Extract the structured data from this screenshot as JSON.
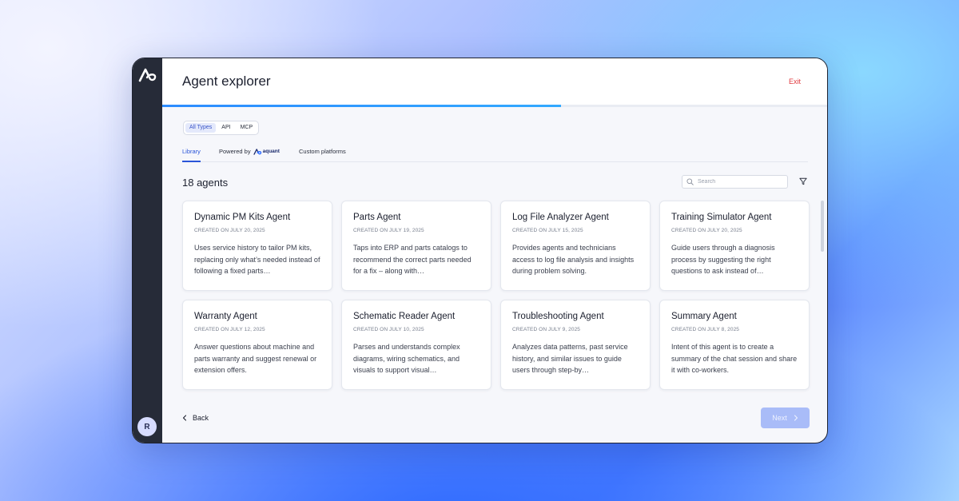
{
  "header": {
    "title": "Agent explorer",
    "exit_label": "Exit"
  },
  "progress": {
    "fraction": 0.6
  },
  "type_filter": {
    "options": [
      "All Types",
      "API",
      "MCP"
    ],
    "selected": "All Types"
  },
  "tabs": [
    {
      "label": "Library",
      "active": true
    },
    {
      "label": "Powered by",
      "brand": "aquant",
      "active": false
    },
    {
      "label": "Custom platforms",
      "active": false
    }
  ],
  "results": {
    "count_label": "18 agents"
  },
  "search": {
    "placeholder": "Search"
  },
  "agents": [
    {
      "name": "Dynamic PM Kits Agent",
      "date": "CREATED ON JULY 20, 2025",
      "description": "Uses service history to tailor PM kits, replacing only what’s needed instead of following a fixed parts…"
    },
    {
      "name": "Parts Agent",
      "date": "CREATED ON JULY 19, 2025",
      "description": "Taps into ERP and parts catalogs to recommend the correct parts needed for a fix – along with…"
    },
    {
      "name": "Log File Analyzer Agent",
      "date": "CREATED ON JULY 15, 2025",
      "description": "Provides agents and technicians access to log file analysis and insights during problem solving."
    },
    {
      "name": "Training Simulator Agent",
      "date": "CREATED ON JULY 20, 2025",
      "description": "Guide users through a diagnosis process by suggesting the right questions to ask instead of…"
    },
    {
      "name": "Warranty Agent",
      "date": "CREATED ON JULY 12, 2025",
      "description": "Answer questions about machine and parts warranty and suggest renewal or extension offers."
    },
    {
      "name": "Schematic Reader Agent",
      "date": "CREATED ON JULY 10, 2025",
      "description": "Parses and understands complex diagrams, wiring schematics, and visuals to support visual…"
    },
    {
      "name": "Troubleshooting Agent",
      "date": "CREATED ON JULY 9, 2025",
      "description": "Analyzes data patterns, past service history, and similar issues to guide users through step-by…"
    },
    {
      "name": "Summary Agent",
      "date": "CREATED ON JULY 8, 2025",
      "description": "Intent of this agent is to create a summary of the chat session and share it with co-workers."
    }
  ],
  "footer": {
    "back_label": "Back",
    "next_label": "Next"
  },
  "user": {
    "initial": "R"
  },
  "colors": {
    "accent": "#2a55d8",
    "exit": "#e0393e",
    "rail": "#262b38",
    "next_disabled": "#a9bcf8"
  }
}
